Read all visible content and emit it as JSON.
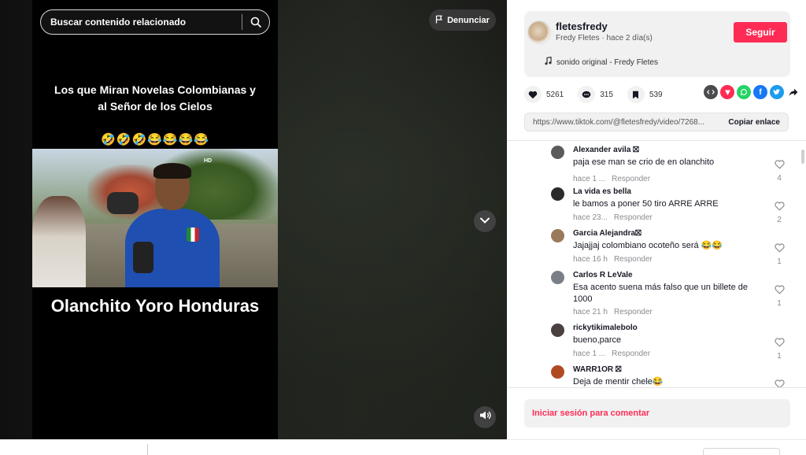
{
  "search": {
    "placeholder": "Buscar contenido relacionado"
  },
  "video": {
    "caption_top": "Los que Miran Novelas Colombianas y al Señor de los Cielos",
    "emojis": "🤣🤣🤣😂😂😂😂",
    "caption_bottom": "Olanchito Yoro Honduras",
    "channel_logo": "HD"
  },
  "report_label": "Denunciar",
  "author": {
    "username": "fletesfredy",
    "display_line": "Fredy Fletes · hace 2 día(s)",
    "follow_label": "Seguir",
    "sound": "sonido original - Fredy Fletes"
  },
  "stats": {
    "likes": "5261",
    "comments": "315",
    "saves": "539"
  },
  "share_icons": [
    "embed-icon",
    "pink-share-icon",
    "whatsapp-icon",
    "facebook-icon",
    "twitter-icon",
    "forward-icon"
  ],
  "link": {
    "url": "https://www.tiktok.com/@fletesfredy/video/7268...",
    "copy_label": "Copiar enlace"
  },
  "comments": [
    {
      "name": "Alexander avila ⛝",
      "text": "paja ese man se crio de en olanchito",
      "time": "hace 1 ...",
      "reply": "Responder",
      "likes": "4",
      "avatar_color": "#5b5b5b"
    },
    {
      "name": "La vida es bella",
      "text": "le bamos a poner 50 tiro ARRE ARRE",
      "time": "hace 23...",
      "reply": "Responder",
      "likes": "2",
      "avatar_color": "#2b2b2b"
    },
    {
      "name": "Garcia Alejandra⛝",
      "text": "Jajajjaj colombiano ocoteño será 😂😂",
      "time": "hace 16 h",
      "reply": "Responder",
      "likes": "1",
      "avatar_color": "#9a7a5a"
    },
    {
      "name": "Carlos R LeVale",
      "text": "Esa acento suena más falso que un billete de 1000",
      "time": "hace 21 h",
      "reply": "Responder",
      "likes": "1",
      "avatar_color": "#7a7f86"
    },
    {
      "name": "rickytikimalebolo",
      "text": "bueno,parce",
      "time": "hace 1 ...",
      "reply": "Responder",
      "likes": "1",
      "avatar_color": "#4a4040"
    },
    {
      "name": "WARR1OR ⛝",
      "text": "Deja de mentir chele😂",
      "time": "",
      "reply": "",
      "likes": "",
      "avatar_color": "#b04a22"
    }
  ],
  "login_prompt": "Iniciar sesión para comentar",
  "colors": {
    "accent": "#fe2c55",
    "panel_bg": "#f1f1f2"
  }
}
